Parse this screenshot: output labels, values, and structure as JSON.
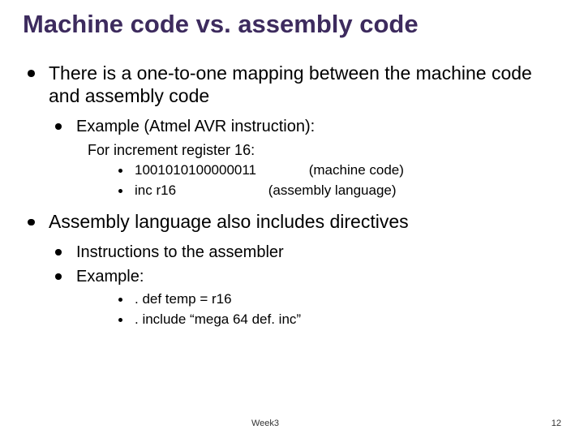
{
  "title": "Machine code vs. assembly code",
  "bullets": {
    "p1": "There is a one-to-one mapping between the machine code and assembly code",
    "p1_1": "Example (Atmel AVR instruction):",
    "p1_1_intro": "For increment register 16:",
    "p1_1_a_code": "1001010100000011",
    "p1_1_a_note": "(machine code)",
    "p1_1_b_code": "inc r16",
    "p1_1_b_note": "(assembly language)",
    "p2": "Assembly language also includes directives",
    "p2_1": "Instructions to the assembler",
    "p2_2": "Example:",
    "p2_2_a": ". def temp = r16",
    "p2_2_b": ". include “mega 64 def. inc”"
  },
  "footer": {
    "left": "Week3",
    "right": "12"
  }
}
